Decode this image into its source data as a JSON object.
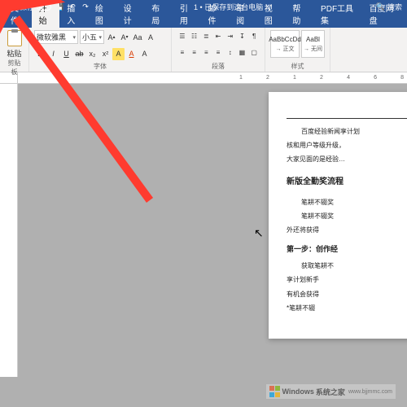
{
  "titlebar": {
    "autosave_label": "自动保存",
    "doc_title": "1 • 已保存到这台电脑 ∨",
    "search_placeholder": "搜索"
  },
  "menubar": {
    "tabs": [
      {
        "label": "文件"
      },
      {
        "label": "开始"
      },
      {
        "label": "插入"
      },
      {
        "label": "绘图"
      },
      {
        "label": "设计"
      },
      {
        "label": "布局"
      },
      {
        "label": "引用"
      },
      {
        "label": "邮件"
      },
      {
        "label": "审阅"
      },
      {
        "label": "视图"
      },
      {
        "label": "帮助"
      },
      {
        "label": "PDF工具集"
      },
      {
        "label": "百度网盘"
      }
    ],
    "active_index": 1
  },
  "ribbon": {
    "clipboard": {
      "paste_label": "粘贴",
      "group_label": "剪贴板"
    },
    "font": {
      "name": "微软雅黑",
      "size": "小五",
      "group_label": "字体",
      "buttons": [
        "A",
        "A",
        "Aa",
        "A"
      ],
      "row2": [
        "B",
        "I",
        "U",
        "ab",
        "x₂",
        "x²",
        "A",
        "A",
        "A"
      ]
    },
    "paragraph": {
      "group_label": "段落"
    },
    "styles": {
      "group_label": "样式",
      "items": [
        {
          "preview": "AaBbCcDd",
          "label": "→ 正文"
        },
        {
          "preview": "AaBl",
          "label": "→ 无间"
        }
      ]
    }
  },
  "ruler": {
    "ticks": [
      "1",
      "2",
      "1",
      "2",
      "4",
      "6",
      "8"
    ]
  },
  "document": {
    "body": [
      "百度经验新闻享计划",
      "核和用户等级升级，",
      "大家见面的是经验…",
      "",
      "新版全勤奖流程",
      "",
      "笔耕不辍奖",
      "笔耕不辍奖",
      "外还将获得",
      "",
      "第一步：创作经",
      "",
      "获取笔耕不",
      "享计划新手",
      "有机会获得",
      "*笔耕不辍"
    ],
    "heading1": "新版全勤奖流程",
    "heading2": "第一步：创作经"
  },
  "watermark": {
    "brand": "Windows",
    "site": "系统之家",
    "url": "www.bjjmmc.com"
  }
}
